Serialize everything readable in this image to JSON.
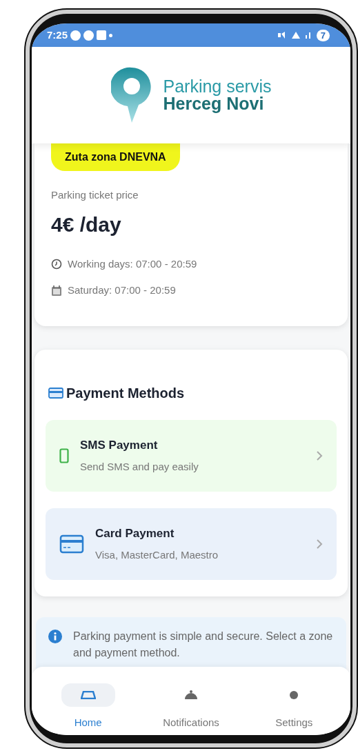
{
  "status_bar": {
    "time": "7:25",
    "battery": "7"
  },
  "header": {
    "logo_line_1": "Parking servis",
    "logo_line_2": "Herceg Novi"
  },
  "zone_card": {
    "zone_badge": "Zuta zona DNEVNA",
    "price_label": "Parking ticket price",
    "price": "4€ /day",
    "schedule": [
      {
        "kind": "clock",
        "text": "Working days: 07:00 - 20:59"
      },
      {
        "kind": "calendar",
        "text": "Saturday: 07:00 - 20:59"
      }
    ]
  },
  "payment": {
    "title": "Payment Methods",
    "methods": [
      {
        "kind": "sms",
        "title": "SMS Payment",
        "subtitle": "Send SMS and pay easily"
      },
      {
        "kind": "card",
        "title": "Card Payment",
        "subtitle": "Visa, MasterCard, Maestro"
      }
    ]
  },
  "info": {
    "text": "Parking payment is simple and secure. Select a zone and payment method."
  },
  "bottom_nav": [
    {
      "kind": "home",
      "label": "Home",
      "selected": true
    },
    {
      "kind": "notifications",
      "label": "Notifications",
      "selected": false
    },
    {
      "kind": "settings",
      "label": "Settings",
      "selected": false
    }
  ]
}
